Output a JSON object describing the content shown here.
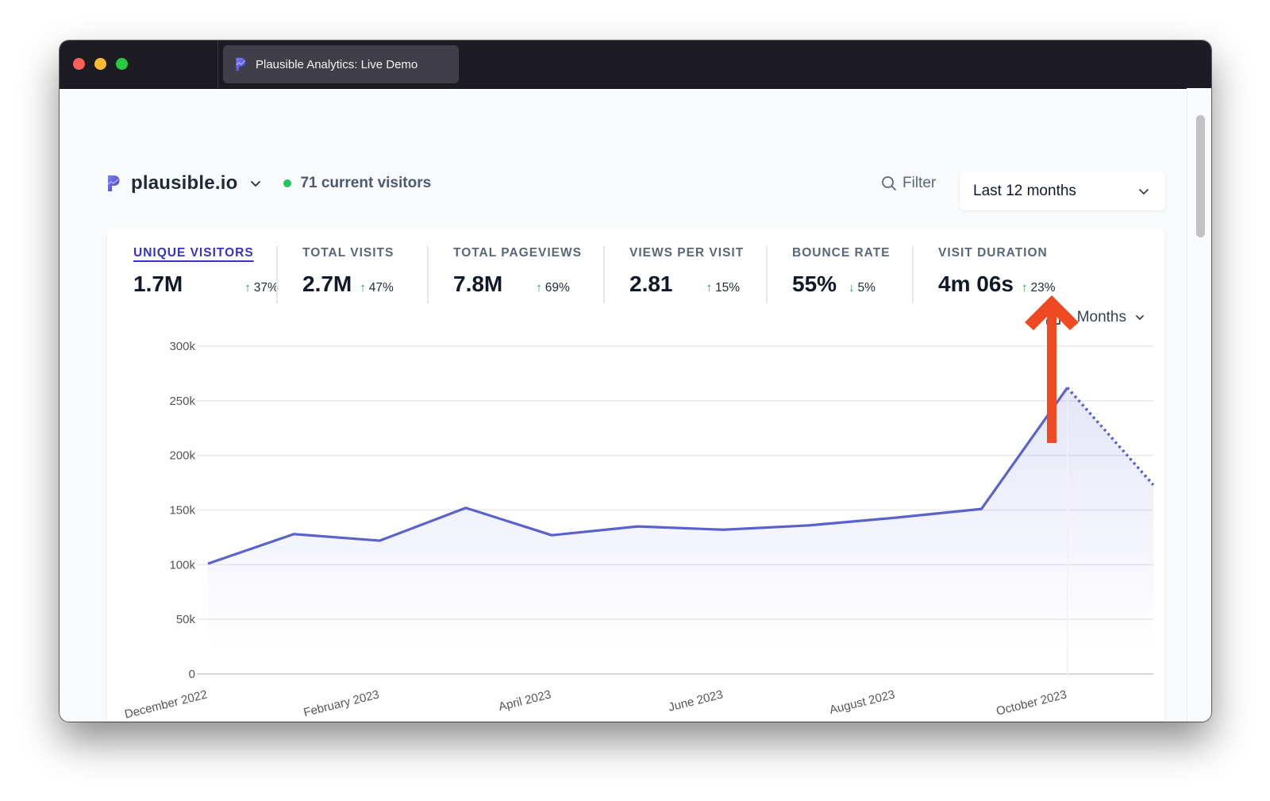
{
  "window": {
    "tab_title": "Plausible Analytics: Live Demo",
    "traffic_lights": [
      "close",
      "minimize",
      "zoom"
    ]
  },
  "header": {
    "site_name": "plausible.io",
    "current_visitors": "71 current visitors",
    "filter_label": "Filter",
    "period_label": "Last 12 months"
  },
  "metrics": [
    {
      "label": "UNIQUE VISITORS",
      "value": "1.7M",
      "direction": "up",
      "change": "37%",
      "active": true
    },
    {
      "label": "TOTAL VISITS",
      "value": "2.7M",
      "direction": "up",
      "change": "47%",
      "active": false
    },
    {
      "label": "TOTAL PAGEVIEWS",
      "value": "7.8M",
      "direction": "up",
      "change": "69%",
      "active": false
    },
    {
      "label": "VIEWS PER VISIT",
      "value": "2.81",
      "direction": "up",
      "change": "15%",
      "active": false
    },
    {
      "label": "BOUNCE RATE",
      "value": "55%",
      "direction": "down",
      "change": "5%",
      "active": false
    },
    {
      "label": "VISIT DURATION",
      "value": "4m 06s",
      "direction": "up",
      "change": "23%",
      "active": false
    }
  ],
  "chart_controls": {
    "download_icon": "download-icon",
    "interval_label": "Months"
  },
  "colors": {
    "accent": "#5a63cb",
    "live": "#22c55e",
    "positive": "#16a34a",
    "annotation": "#f04a23"
  },
  "chart_data": {
    "type": "area",
    "title": "",
    "xlabel": "",
    "ylabel": "",
    "ylim": [
      0,
      300000
    ],
    "yticks": [
      0,
      50000,
      100000,
      150000,
      200000,
      250000,
      300000
    ],
    "ytick_labels": [
      "0",
      "50k",
      "100k",
      "150k",
      "200k",
      "250k",
      "300k"
    ],
    "categories": [
      "December 2022",
      "January 2023",
      "February 2023",
      "March 2023",
      "April 2023",
      "May 2023",
      "June 2023",
      "July 2023",
      "August 2023",
      "September 2023",
      "October 2023",
      "November 2023"
    ],
    "xtick_labels": [
      "December 2022",
      "February 2023",
      "April 2023",
      "June 2023",
      "August 2023",
      "October 2023"
    ],
    "series": [
      {
        "name": "Unique visitors",
        "values": [
          101000,
          128000,
          122000,
          152000,
          127000,
          135000,
          132000,
          136000,
          143000,
          151000,
          262000,
          173000
        ]
      }
    ],
    "incomplete_last_point": true,
    "grid": true,
    "legend": "none"
  },
  "annotation": {
    "type": "arrow",
    "points_to": "download-button"
  }
}
